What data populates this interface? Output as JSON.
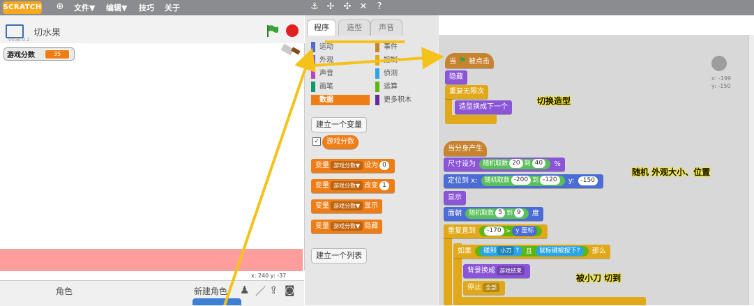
{
  "menubar": {
    "logo": "SCRATCH",
    "items": [
      "文件▼",
      "编辑▼",
      "技巧",
      "关于"
    ]
  },
  "stage": {
    "title": "切水果",
    "version": "v456.0.2",
    "variable_monitor": {
      "name": "游戏分数",
      "value": "35"
    },
    "coords": "x: 240  y: -37"
  },
  "sprites": {
    "label": "角色",
    "new_sprite_label": "新建角色："
  },
  "tabs": [
    "程序",
    "造型",
    "声音"
  ],
  "categories_left": [
    {
      "label": "运动",
      "color": "#4a6cd4"
    },
    {
      "label": "外观",
      "color": "#8a55d7"
    },
    {
      "label": "声音",
      "color": "#bb42c3"
    },
    {
      "label": "画笔",
      "color": "#0e9a6c"
    },
    {
      "label": "数据",
      "color": "#ee7d16",
      "active": true
    }
  ],
  "categories_right": [
    {
      "label": "事件",
      "color": "#c88330"
    },
    {
      "label": "控制",
      "color": "#e1a91a"
    },
    {
      "label": "侦测",
      "color": "#2ca5e2"
    },
    {
      "label": "运算",
      "color": "#5cb712"
    },
    {
      "label": "更多积木",
      "color": "#632d99"
    }
  ],
  "palette": {
    "make_var": "建立一个变量",
    "var_name": "游戏分数",
    "set_blocks": [
      {
        "prefix": "变量",
        "var": "游戏分数▼",
        "suffix": "设为",
        "arg": "0"
      },
      {
        "prefix": "变量",
        "var": "游戏分数▼",
        "suffix": "改变",
        "arg": "1"
      },
      {
        "prefix": "变量",
        "var": "游戏分数▼",
        "suffix": "显示",
        "arg": ""
      },
      {
        "prefix": "变量",
        "var": "游戏分数▼",
        "suffix": "隐藏",
        "arg": ""
      }
    ],
    "make_list": "建立一个列表"
  },
  "scripts": {
    "hat1": {
      "pre": "当",
      "post": "被点击"
    },
    "hide": "隐藏",
    "forever": "重复无限次",
    "next_costume": "造型换成下一个",
    "hat2": "当分身产生",
    "size": {
      "label": "尺寸设为",
      "rand": "随机取数",
      "a": "20",
      "to": "到",
      "b": "40",
      "pct": "%"
    },
    "goto": {
      "label": "定位到 x:",
      "rand": "随机取数",
      "a": "-200",
      "to": "到",
      "b": "-120",
      "y": "y:",
      "yv": "-150"
    },
    "show": "显示",
    "point": {
      "label": "面朝",
      "rand": "随机取数",
      "a": "5",
      "to": "到",
      "b": "9",
      "deg": "度"
    },
    "repeat_until": {
      "label": "重复直到",
      "a": "-170",
      "op": ">",
      "b": "y 座标"
    },
    "if_block": {
      "label": "如果",
      "touch": "碰到",
      "knife": "小刀",
      "q": "?",
      "and": "且",
      "mouse": "鼠标键被按下?",
      "then": "那么"
    },
    "backdrop": {
      "label": "背景换成",
      "val": "游戏结束"
    },
    "stop": {
      "label": "停止",
      "val": "全部"
    }
  },
  "annotations": {
    "a1": "切换造型",
    "a2": "随机 外观大小、位置",
    "a3": "被小刀 切到"
  },
  "script_coords": {
    "x": "x: -199",
    "y": "y: -150"
  },
  "colors": {
    "arrow": "#f5c21b",
    "events": "#c88330",
    "looks": "#8a55d7",
    "control": "#e1a91a",
    "operators": "#5cb712",
    "motion": "#4a6cd4",
    "sensing": "#2ca5e2",
    "data": "#ee7d16"
  }
}
